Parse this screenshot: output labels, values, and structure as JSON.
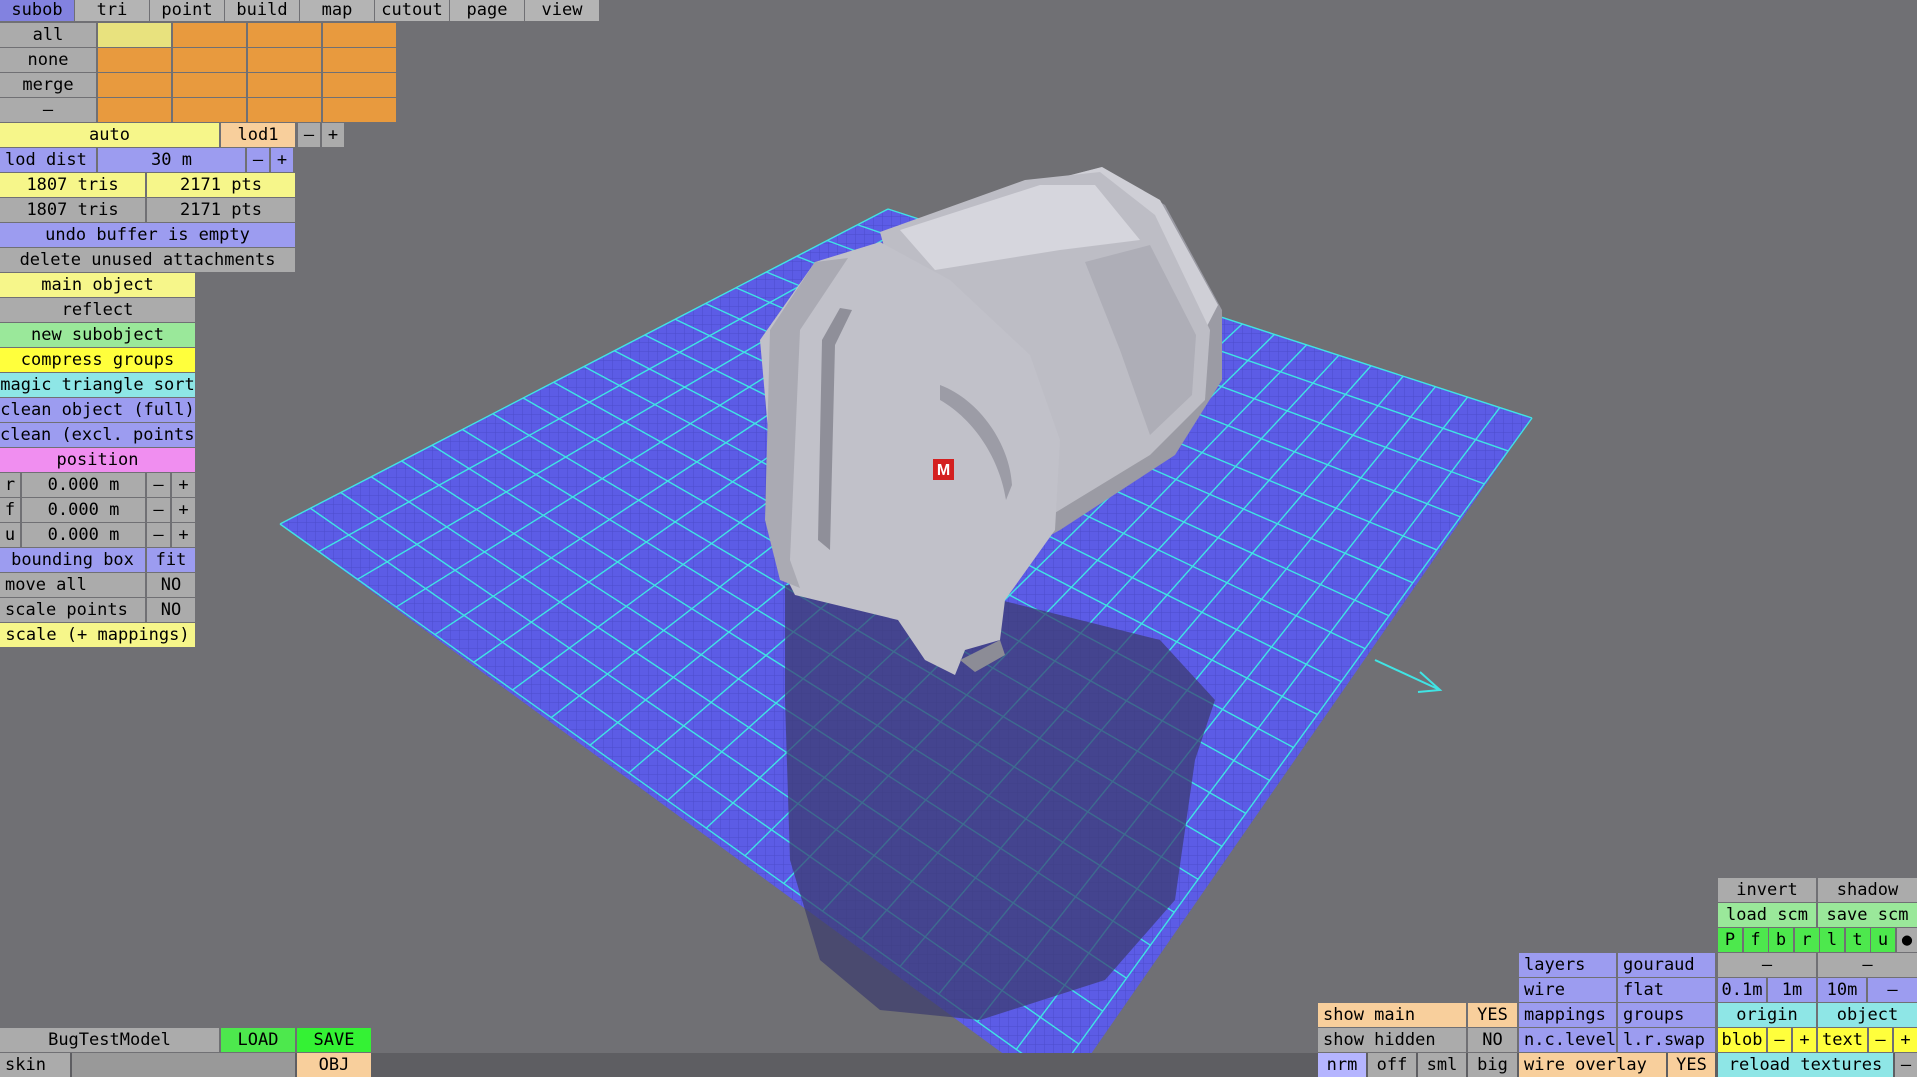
{
  "tabs": [
    "subob",
    "tri",
    "point",
    "build",
    "map",
    "cutout",
    "page",
    "view"
  ],
  "active_tab": "subob",
  "select": {
    "all": "all",
    "none": "none",
    "merge": "merge",
    "dash": "–"
  },
  "colors": {
    "swatch_highlight": "#e8e27e",
    "swatch": "#e89a3e",
    "grid_fill": "#5c5ce6",
    "grid_line": "#40e4e4",
    "model": "#c8c8d0",
    "marker": "#d42020"
  },
  "lod": {
    "auto": "auto",
    "name": "lod1",
    "minus": "–",
    "plus": "+"
  },
  "lod_dist": {
    "label": "lod dist",
    "value": "30 m",
    "minus": "–",
    "plus": "+"
  },
  "stats": [
    {
      "tris": "1807 tris",
      "pts": "2171 pts"
    },
    {
      "tris": "1807 tris",
      "pts": "2171 pts"
    }
  ],
  "undo": "undo buffer is empty",
  "delete_unused": "delete unused attachments",
  "actions": {
    "main_object": "main object",
    "reflect": "reflect",
    "new_subobject": "new subobject",
    "compress_groups": "compress groups",
    "magic_sort": "magic triangle sort",
    "clean_full": "clean object (full)",
    "clean_excl": "clean (excl. points)",
    "position": "position"
  },
  "position": [
    {
      "axis": "r",
      "value": "0.000 m"
    },
    {
      "axis": "f",
      "value": "0.000 m"
    },
    {
      "axis": "u",
      "value": "0.000 m"
    }
  ],
  "minus": "–",
  "plus": "+",
  "bbox": {
    "label": "bounding box",
    "fit": "fit"
  },
  "move_all": {
    "label": "move all",
    "value": "NO"
  },
  "scale_points": {
    "label": "scale points",
    "value": "NO"
  },
  "scale_mappings": "scale (+ mappings)",
  "marker_letter": "M",
  "file": {
    "name": "BugTestModel",
    "load": "LOAD",
    "save": "SAVE",
    "skin": "skin",
    "obj": "OBJ"
  },
  "display": {
    "show_main": "show main",
    "show_main_val": "YES",
    "show_hidden": "show hidden",
    "show_hidden_val": "NO",
    "nrm": "nrm",
    "off": "off",
    "sml": "sml",
    "big": "big",
    "layers": "layers",
    "gouraud": "gouraud",
    "wire": "wire",
    "flat": "flat",
    "mappings": "mappings",
    "groups": "groups",
    "nclevel": "n.c.level",
    "lrswap": "l.r.swap",
    "wire_overlay": "wire overlay",
    "wire_overlay_val": "YES"
  },
  "right": {
    "invert": "invert",
    "shadow": "shadow",
    "load_scm": "load scm",
    "save_scm": "save scm",
    "views": [
      "P",
      "f",
      "b",
      "r",
      "l",
      "t",
      "u"
    ],
    "dot": "●",
    "dash1": "–",
    "dash2": "–",
    "grid_01": "0.1m",
    "grid_1": "1m",
    "grid_10": "10m",
    "grid_minus": "–",
    "origin": "origin",
    "object": "object",
    "blob": "blob",
    "text": "text",
    "reload": "reload textures"
  }
}
